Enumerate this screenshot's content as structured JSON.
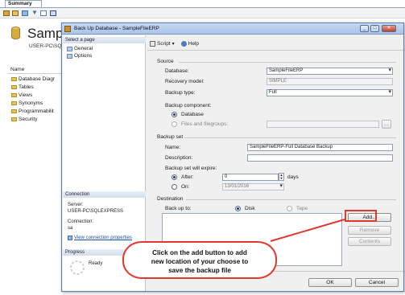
{
  "background": {
    "tab": "Summary",
    "title": "Samp",
    "subtitle": "USER-PC\\SQ",
    "tree_header": "Name",
    "tree_items": [
      "Database Diagr",
      "Tables",
      "Views",
      "Synonyms",
      "Programmabilit",
      "Security"
    ]
  },
  "dialog": {
    "title": "Back Up Database - SampleFileERP",
    "window_buttons": {
      "min": "_",
      "max": "□",
      "close": "✕"
    },
    "select_page_header": "Select a page",
    "pages": [
      "General",
      "Options"
    ],
    "connection_header": "Connection",
    "server_label": "Server:",
    "server_value": "USER-PC\\SQLEXPRESS",
    "connection_label": "Connection:",
    "connection_value": "sa",
    "view_connection_link": "View connection properties",
    "progress_header": "Progress",
    "progress_status": "Ready",
    "toolbar": {
      "script": "Script",
      "help": "Help"
    },
    "source": {
      "header": "Source",
      "database_label": "Database:",
      "database_value": "SampleFileERP",
      "recovery_label": "Recovery model:",
      "recovery_value": "SIMPLE",
      "backup_type_label": "Backup type:",
      "backup_type_value": "Full",
      "component_label": "Backup component:",
      "component_database": "Database",
      "component_files": "Files and filegroups:"
    },
    "backup_set": {
      "header": "Backup set",
      "name_label": "Name:",
      "name_value": "SampleFileERP-Full Database Backup",
      "description_label": "Description:",
      "expire_label": "Backup set will expire:",
      "after_label": "After:",
      "after_value": "0",
      "days_label": "days",
      "on_label": "On:",
      "on_value": "13/01/2016"
    },
    "destination": {
      "header": "Destination",
      "backup_to_label": "Back up to:",
      "disk_label": "Disk",
      "tape_label": "Tape",
      "add_button": "Add...",
      "remove_button": "Remove",
      "contents_button": "Contents"
    },
    "ok_button": "OK",
    "cancel_button": "Cancel"
  },
  "annotation": {
    "callout_line1": "Click on the add button to add",
    "callout_line2": "new location  of your choose to",
    "callout_line3": "save the backup file",
    "color": "#e03a2e"
  }
}
